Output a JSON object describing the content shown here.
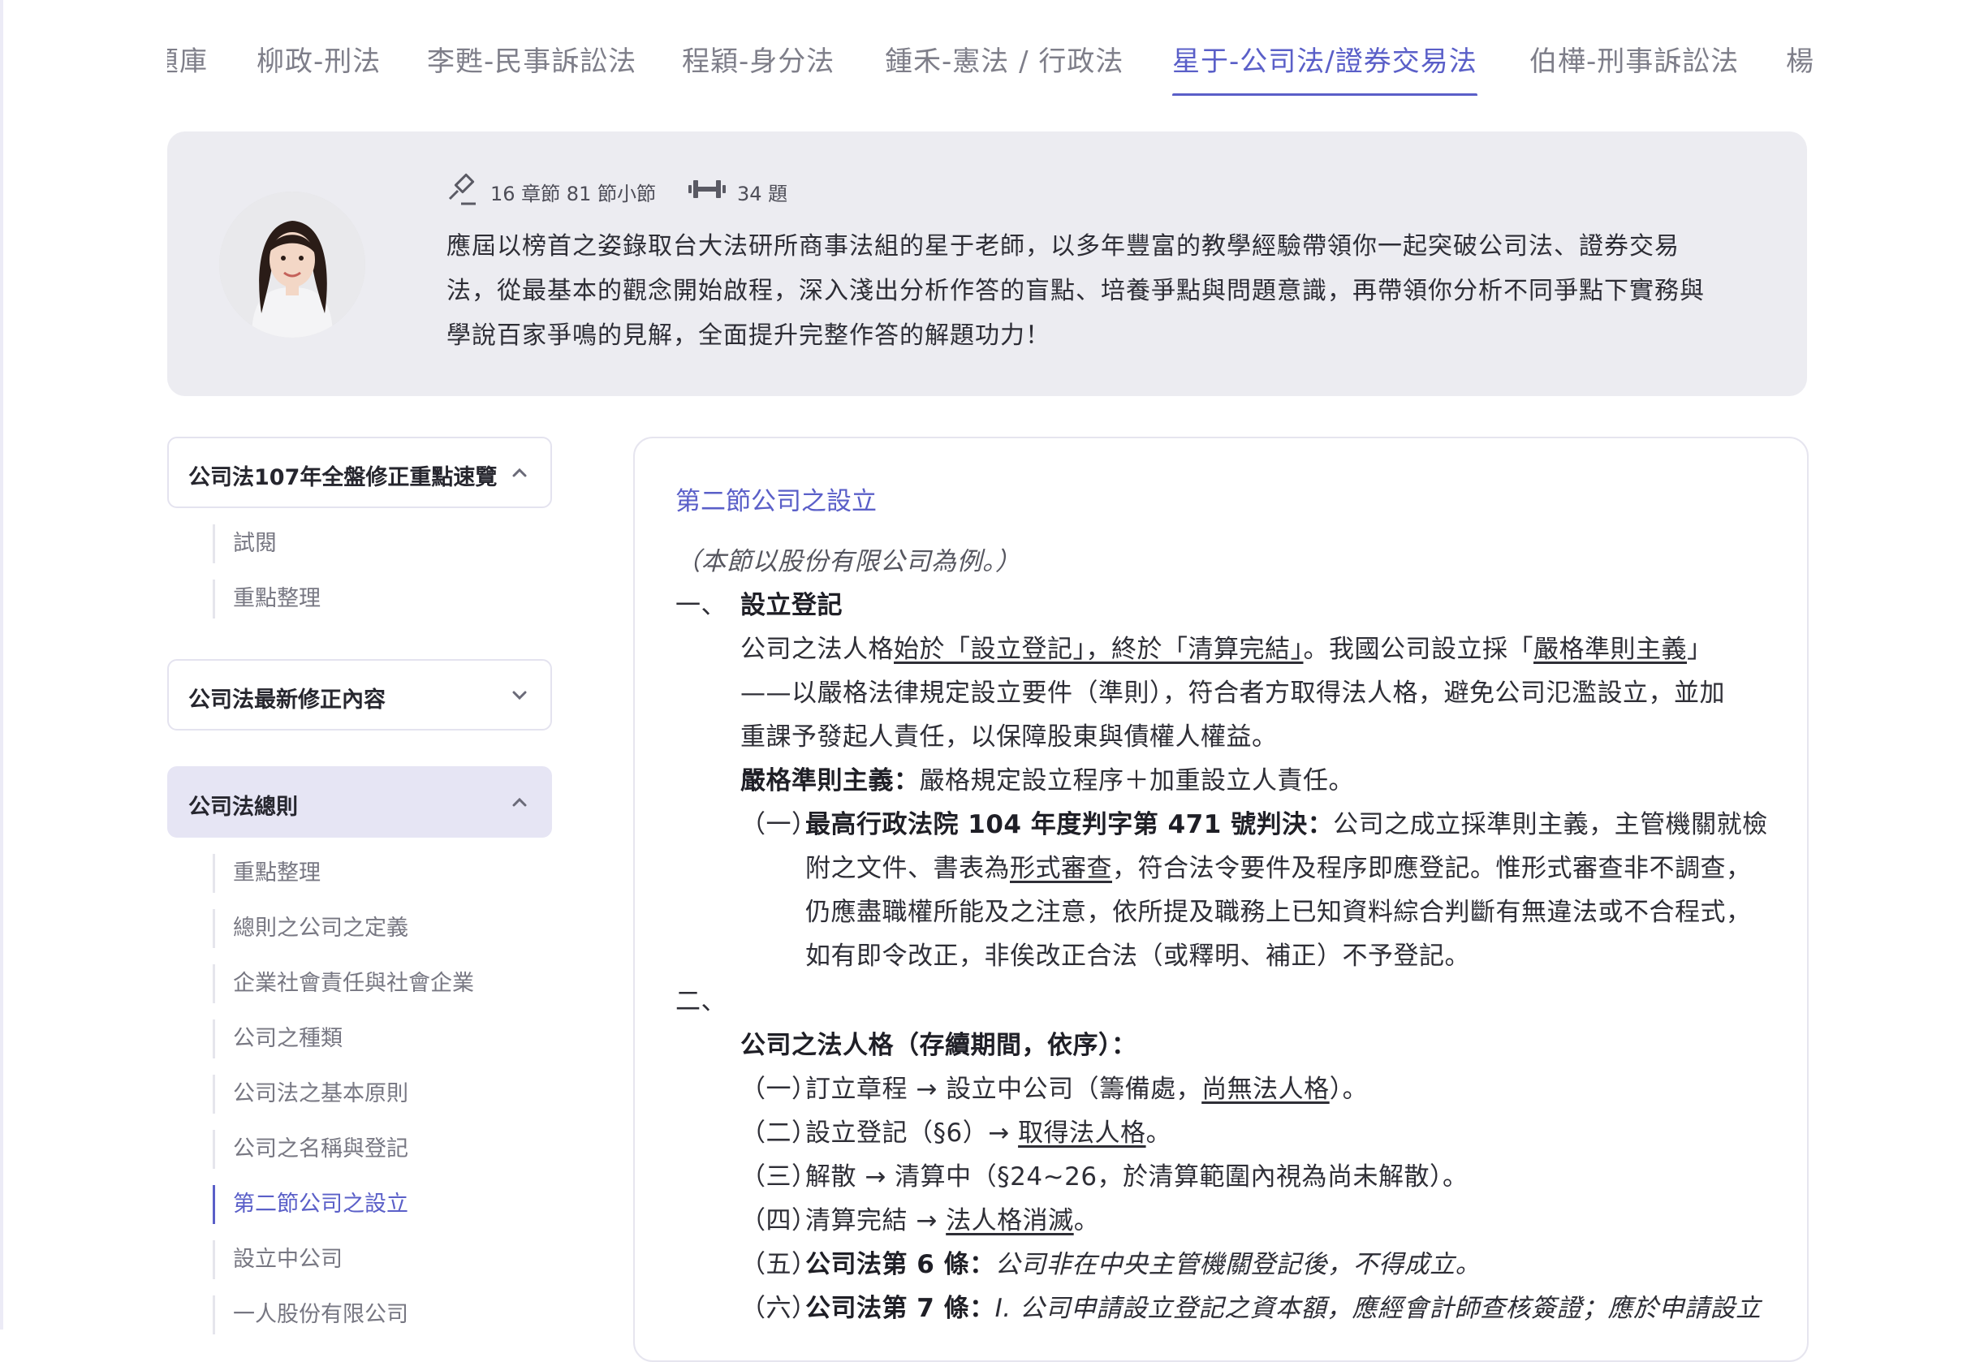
{
  "tabs": [
    {
      "label": "題庫"
    },
    {
      "label": "柳政-刑法"
    },
    {
      "label": "李甦-民事訴訟法"
    },
    {
      "label": "程穎-身分法"
    },
    {
      "label": "鍾禾-憲法 / 行政法"
    },
    {
      "label": "星于-公司法/證券交易法"
    },
    {
      "label": "伯樺-刑事訴訟法"
    },
    {
      "label": "楊"
    }
  ],
  "instructor": {
    "chapters": "16 章節 81 節小節",
    "questions": "34 題",
    "desc_lines": [
      "應屆以榜首之姿錄取台大法研所商事法組的星于老師，以多年豐富的教學經驗帶領你一起突破公司法、證券交易",
      "法，從最基本的觀念開始啟程，深入淺出分析作答的盲點、培養爭點與問題意識，再帶領你分析不同爭點下實務與",
      "學說百家爭鳴的見解，全面提升完整作答的解題功力！"
    ]
  },
  "sidebar": {
    "sections": [
      {
        "label": "公司法107年全盤修正重點速覽",
        "items": [
          "試閱",
          "重點整理"
        ]
      },
      {
        "label": "公司法最新修正內容"
      },
      {
        "label": "公司法總則",
        "items": [
          "重點整理",
          "總則之公司之定義",
          "企業社會責任與社會企業",
          "公司之種類",
          "公司法之基本原則",
          "公司之名稱與登記",
          "第二節公司之設立",
          "設立中公司",
          "一人股份有限公司"
        ]
      }
    ]
  },
  "content": {
    "title": "第二節公司之設立",
    "note": "（本節以股份有限公司為例。）",
    "s1_num": "一、",
    "s1_title": "設立登記",
    "p1_pre": "公司之法人格",
    "p1_u1": "始於「設立登記」，終於「清算完結」",
    "p1_mid": "。我國公司設立採「",
    "p1_u2": "嚴格準則主義",
    "p1_end": "」",
    "p1_l2": "——以嚴格法律規定設立要件（準則），符合者方取得法人格，避免公司氾濫設立，並加",
    "p1_l3": "重課予發起人責任，以保障股東與債權人權益。",
    "strict_b": "嚴格準則主義：",
    "strict_t": "嚴格規定設立程序＋加重設立人責任。",
    "case_num": "（一）",
    "case_b": "最高行政法院 104 年度判字第 471 號判決：",
    "case_l1": "公司之成立採準則主義，主管機關就檢",
    "case_l2_pre": "附之文件、書表為",
    "case_l2_u": "形式審查",
    "case_l2_end": "，符合法令要件及程序即應登記。惟形式審查非不調查，",
    "case_l3": "仍應盡職權所能及之注意，依所提及職務上已知資料綜合判斷有無違法或不合程式，",
    "case_l4": "如有即令改正，非俟改正合法（或釋明、補正）不予登記。",
    "s2_num": "二、",
    "s2_title": "公司之法人格（存續期間，依序）：",
    "list": [
      {
        "num": "（一）",
        "pre": "訂立章程 → 設立中公司（籌備處，",
        "u": "尚無法人格",
        "end": "）。"
      },
      {
        "num": "（二）",
        "pre": "設立登記（§6）→ ",
        "u": "取得法人格",
        "end": "。"
      },
      {
        "num": "（三）",
        "pre": "解散 → 清算中（§24~26，於清算範圍內視為尚未解散）。",
        "u": "",
        "end": ""
      },
      {
        "num": "（四）",
        "pre": "清算完結 → ",
        "u": "法人格消滅",
        "end": "。"
      }
    ],
    "art6_num": "（五）",
    "art6_b": "公司法第 6 條：",
    "art6_t": "公司非在中央主管機關登記後，不得成立。",
    "art7_num": "（六）",
    "art7_b": "公司法第 7 條：",
    "art7_t": "I. 公司申請設立登記之資本額，應經會計師查核簽證；應於申請設立"
  }
}
